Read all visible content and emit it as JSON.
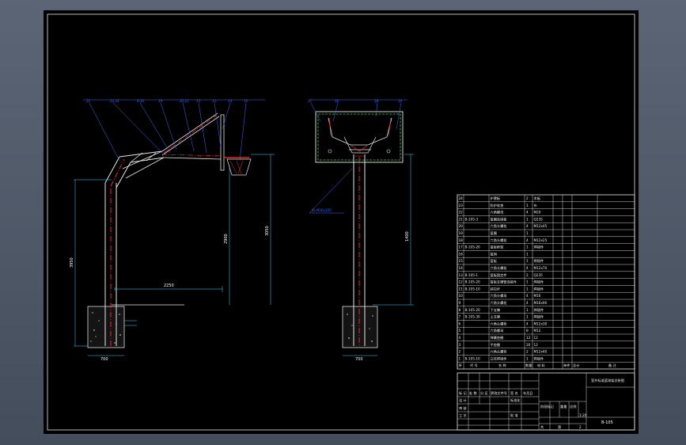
{
  "drawing": {
    "number": "B-105",
    "title_main": "室外标准篮球架总装图",
    "scale": "1:20",
    "sheet_count": "2"
  },
  "dimensions": {
    "base_width_left": "700",
    "base_width_right": "700",
    "reach": "2250",
    "overall_height": "3950",
    "rim_height": "3050",
    "board_height": "2900",
    "mid_dim": "1400",
    "right_callout": "4L-M16x150"
  },
  "leaders_left": [
    "21",
    "22,23",
    "9,10",
    "19",
    "20,21",
    "15",
    "13",
    "14",
    "16"
  ],
  "leaders_right": [
    "17",
    "16",
    "18",
    "19"
  ],
  "bom_rows": [
    {
      "no": "24",
      "code": "",
      "name": "护罩板",
      "qty": "2",
      "material": "木板"
    },
    {
      "no": "23",
      "code": "",
      "name": "防护软垫",
      "qty": "1",
      "material": "布"
    },
    {
      "no": "22",
      "code": "",
      "name": "六角螺母",
      "qty": "4",
      "material": "M20"
    },
    {
      "no": "21",
      "code": "B-105-3",
      "name": "篮圈连接板",
      "qty": "1",
      "material": "Q235"
    },
    {
      "no": "20",
      "code": "",
      "name": "六角头螺栓",
      "qty": "4",
      "material": "M12x45"
    },
    {
      "no": "19",
      "code": "",
      "name": "篮圈",
      "qty": "1",
      "material": ""
    },
    {
      "no": "18",
      "code": "",
      "name": "六角头螺栓",
      "qty": "4",
      "material": "M12x25"
    },
    {
      "no": "17",
      "code": "B-105-20",
      "name": "篮板框架",
      "qty": "1",
      "material": "焊接件"
    },
    {
      "no": "16",
      "code": "",
      "name": "篮网",
      "qty": "1",
      "material": ""
    },
    {
      "no": "15",
      "code": "",
      "name": "篮板",
      "qty": "1",
      "material": "焊接件"
    },
    {
      "no": "14",
      "code": "",
      "name": "六角头螺栓",
      "qty": "4",
      "material": "M12x70"
    },
    {
      "no": "13",
      "code": "B-105-1",
      "name": "篮板固定件",
      "qty": "2",
      "material": "Q235"
    },
    {
      "no": "12",
      "code": "B-105-20",
      "name": "篮板支撑管连接件",
      "qty": "1",
      "material": "焊接件"
    },
    {
      "no": "11",
      "code": "B-105-10",
      "name": "斜拉杆",
      "qty": "1",
      "material": "焊接件"
    },
    {
      "no": "10",
      "code": "",
      "name": "六角头螺母",
      "qty": "4",
      "material": "M16"
    },
    {
      "no": "9",
      "code": "",
      "name": "六角头螺栓",
      "qty": "4",
      "material": "M16x90"
    },
    {
      "no": "8",
      "code": "B-105-20",
      "name": "下支撑",
      "qty": "1",
      "material": "焊接件"
    },
    {
      "no": "7",
      "code": "B-105-30",
      "name": "上支撑",
      "qty": "1",
      "material": "焊接件"
    },
    {
      "no": "6",
      "code": "",
      "name": "六角头螺栓",
      "qty": "4",
      "material": "M12x30"
    },
    {
      "no": "5",
      "code": "",
      "name": "六角螺母",
      "qty": "8",
      "material": "M12"
    },
    {
      "no": "4",
      "code": "",
      "name": "弹簧垫圈",
      "qty": "12",
      "material": "12"
    },
    {
      "no": "3",
      "code": "",
      "name": "平垫圈",
      "qty": "20",
      "material": "12"
    },
    {
      "no": "2",
      "code": "",
      "name": "六角头螺栓",
      "qty": "2",
      "material": "M12x40"
    },
    {
      "no": "1",
      "code": "B-105-10",
      "name": "立柱焊接件",
      "qty": "1",
      "material": "焊接件"
    }
  ],
  "bom_header": {
    "no": "序",
    "code": "代 号",
    "name": "名 称",
    "qty": "数量",
    "material": "材 料",
    "unit": "单件",
    "total": "总计",
    "remark": "备 注"
  },
  "title_block": {
    "mark": "标 记",
    "count": "处 数",
    "zone": "分 区",
    "change": "更改文件号",
    "sign": "签 名",
    "date": "年月日",
    "design": "设 计",
    "standard": "标准化",
    "check": "审 核",
    "process": "工 艺",
    "approve": "批 准",
    "stage": "阶段标记",
    "weight": "重量",
    "ratio": "比例",
    "sheets_total": "共",
    "sheets_of": "第"
  }
}
